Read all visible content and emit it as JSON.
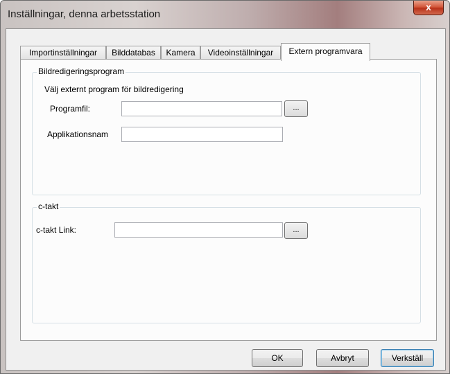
{
  "window": {
    "title": "Inställningar, denna arbetsstation",
    "close_label": "x"
  },
  "tabs": [
    {
      "label": "Importinställningar",
      "active": false
    },
    {
      "label": "Bilddatabas",
      "active": false
    },
    {
      "label": "Kamera",
      "active": false
    },
    {
      "label": "Videoinställningar",
      "active": false
    },
    {
      "label": "Extern programvara",
      "active": true
    }
  ],
  "image_editing": {
    "group_title": "Bildredigeringsprogram",
    "description": "Välj externt program för bildredigering",
    "program_file_label": "Programfil:",
    "program_file_value": "",
    "program_file_browse": "...",
    "app_name_label": "Applikationsnam",
    "app_name_value": ""
  },
  "ctakt": {
    "group_title": "c-takt",
    "link_label": "c-takt Link:",
    "link_value": "",
    "link_browse": "..."
  },
  "buttons": {
    "ok": "OK",
    "cancel": "Avbryt",
    "apply": "Verkställ"
  }
}
